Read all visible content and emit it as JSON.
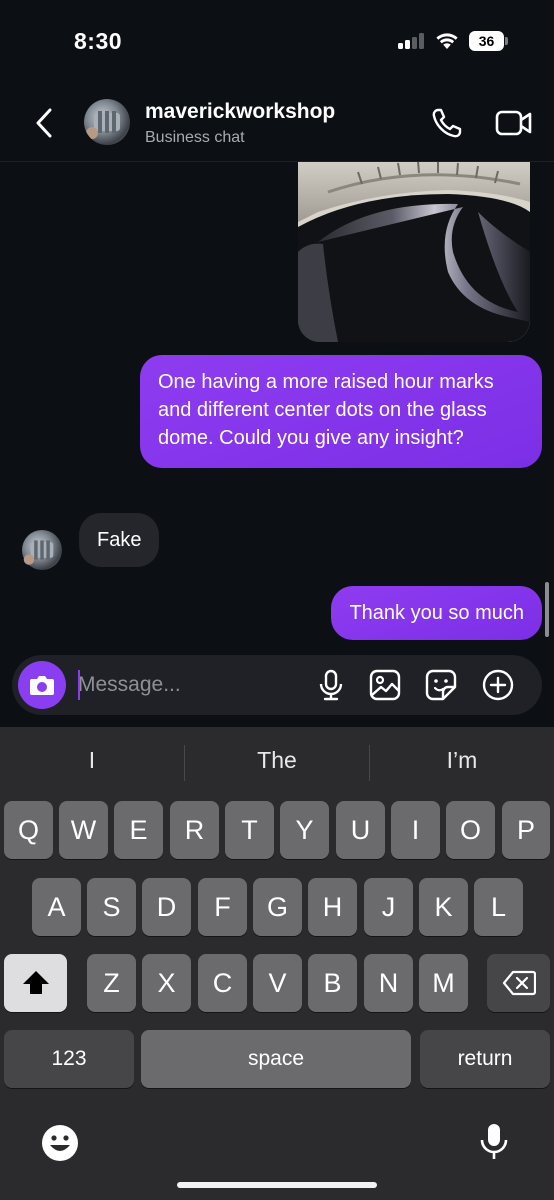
{
  "status_bar": {
    "time": "8:30",
    "battery": "36",
    "signal_bars_active": 2,
    "signal_bars_total": 4
  },
  "header": {
    "contact_name": "maverickworkshop",
    "subtitle": "Business chat",
    "icons": [
      "chevron-left-icon",
      "phone-icon",
      "video-camera-icon"
    ]
  },
  "messages": [
    {
      "direction": "outgoing",
      "type": "image"
    },
    {
      "direction": "outgoing",
      "type": "text",
      "text": "One having a more raised hour marks and different center dots on the glass dome. Could you give any insight?"
    },
    {
      "direction": "incoming",
      "type": "text",
      "text": "Fake"
    },
    {
      "direction": "outgoing",
      "type": "text",
      "text": "Thank you so much"
    }
  ],
  "composer": {
    "placeholder": "Message...",
    "value": "",
    "icons": [
      "camera-icon",
      "microphone-icon",
      "gallery-icon",
      "sticker-icon",
      "plus-icon"
    ]
  },
  "keyboard": {
    "suggestions": [
      "I",
      "The",
      "I’m"
    ],
    "row1": [
      "Q",
      "W",
      "E",
      "R",
      "T",
      "Y",
      "U",
      "I",
      "O",
      "P"
    ],
    "row2": [
      "A",
      "S",
      "D",
      "F",
      "G",
      "H",
      "J",
      "K",
      "L"
    ],
    "row3": [
      "Z",
      "X",
      "C",
      "V",
      "B",
      "N",
      "M"
    ],
    "numbers_label": "123",
    "space_label": "space",
    "return_label": "return",
    "icons": [
      "shift-icon",
      "backspace-icon",
      "emoji-icon",
      "dictation-icon"
    ]
  },
  "colors": {
    "accent": "#8a3ef2",
    "background": "#0c0f14",
    "incoming_bubble": "#24262b",
    "keyboard": "#2b2b2d"
  }
}
